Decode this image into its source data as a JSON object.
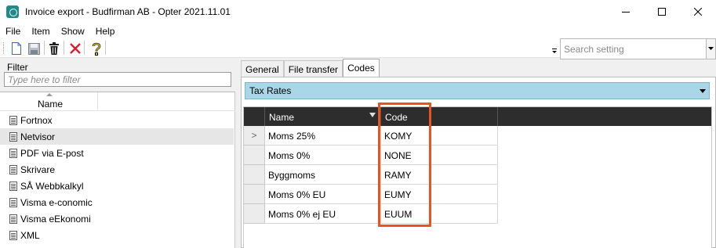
{
  "window": {
    "title": "Invoice export - Budfirman AB - Opter 2021.11.01"
  },
  "menu": {
    "items": [
      "File",
      "Item",
      "Show",
      "Help"
    ]
  },
  "toolbar": {
    "search_placeholder": "Search setting"
  },
  "filter": {
    "label": "Filter",
    "placeholder": "Type here to filter"
  },
  "list": {
    "column_header": "Name",
    "items": [
      "Fortnox",
      "Netvisor",
      "PDF via E-post",
      "Skrivare",
      "SÅ Webbkalkyl",
      "Visma e-conomic",
      "Visma eEkonomi",
      "XML"
    ],
    "selected_index": 1
  },
  "tabs": {
    "items": [
      "General",
      "File transfer",
      "Codes"
    ],
    "active_index": 2
  },
  "codes": {
    "combo_value": "Tax Rates",
    "columns": [
      "Name",
      "Code"
    ],
    "rows": [
      {
        "name": "Moms 25%",
        "code": "KOMY",
        "current": true
      },
      {
        "name": "Moms 0%",
        "code": "NONE"
      },
      {
        "name": "Byggmoms",
        "code": "RAMY"
      },
      {
        "name": "Moms 0% EU",
        "code": "EUMY"
      },
      {
        "name": "Moms 0% ej EU",
        "code": "EUUM"
      }
    ],
    "current_row_marker": ">"
  },
  "colors": {
    "highlight": "#e8531f",
    "combo_background": "#aad7e7",
    "grid_header": "#2d2d2d"
  }
}
